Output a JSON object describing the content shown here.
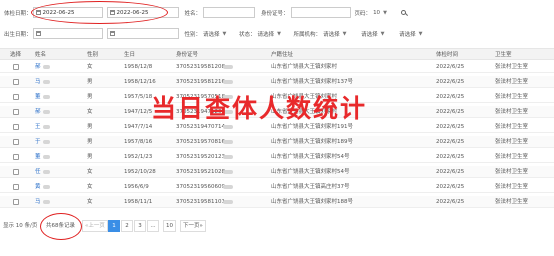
{
  "filters": {
    "exam_date_label": "体检日期：",
    "exam_date_start": "2022-06-25",
    "exam_date_end": "2022-06-25",
    "name_label": "姓名：",
    "name_value": "",
    "id_label": "身份证号：",
    "id_value": "",
    "page_label": "页码：",
    "page_value": "10",
    "birth_date_label": "出生日期：",
    "birth_date_start": "",
    "birth_date_end": "",
    "gender_label": "性别：",
    "gender_value": "请选择",
    "status_label": "状态：",
    "status_value": "请选择",
    "org_label": "所属机构：",
    "org_value": "请选择",
    "select4_value": "请选择",
    "select5_value": "请选择"
  },
  "table": {
    "headers": {
      "select": "选择",
      "name": "姓名",
      "gender": "性别",
      "birth": "生日",
      "id": "身份证号",
      "address": "户籍住址",
      "exam_time": "体检时间",
      "clinic": "卫生室"
    },
    "rows": [
      {
        "name": "郝",
        "gender": "女",
        "birth": "1958/12/8",
        "id": "37052319581208",
        "address": "山东省广饶县大王镇刘家村",
        "exam_time": "2022/6/25",
        "clinic": "张法村卫生室"
      },
      {
        "name": "马",
        "gender": "男",
        "birth": "1958/12/16",
        "id": "37052319581216",
        "address": "山东省广饶县大王镇刘家村137号",
        "exam_time": "2022/6/25",
        "clinic": "张法村卫生室"
      },
      {
        "name": "董",
        "gender": "男",
        "birth": "1957/5/18",
        "id": "37052319570518",
        "address": "山东省广饶县大王镇刘家村",
        "exam_time": "2022/6/25",
        "clinic": "张法村卫生室"
      },
      {
        "name": "郝",
        "gender": "女",
        "birth": "1947/12/5",
        "id": "37052319471205",
        "address": "山东省广饶县大王镇刘家村",
        "exam_time": "2022/6/25",
        "clinic": "张法村卫生室"
      },
      {
        "name": "王",
        "gender": "男",
        "birth": "1947/7/14",
        "id": "37052319470714",
        "address": "山东省广饶县大王镇刘家村191号",
        "exam_time": "2022/6/25",
        "clinic": "张法村卫生室"
      },
      {
        "name": "于",
        "gender": "男",
        "birth": "1957/8/16",
        "id": "37052319570816",
        "address": "山东省广饶县大王镇刘家村189号",
        "exam_time": "2022/6/25",
        "clinic": "张法村卫生室"
      },
      {
        "name": "董",
        "gender": "男",
        "birth": "1952/1/23",
        "id": "37052319520123",
        "address": "山东省广饶县大王镇刘家村54号",
        "exam_time": "2022/6/25",
        "clinic": "张法村卫生室"
      },
      {
        "name": "任",
        "gender": "女",
        "birth": "1952/10/28",
        "id": "37052319521028",
        "address": "山东省广饶县大王镇刘家村54号",
        "exam_time": "2022/6/25",
        "clinic": "张法村卫生室"
      },
      {
        "name": "黄",
        "gender": "女",
        "birth": "1956/6/9",
        "id": "37052319560609",
        "address": "山东省广饶县大王镇高庄村37号",
        "exam_time": "2022/6/25",
        "clinic": "张法村卫生室"
      },
      {
        "name": "马",
        "gender": "女",
        "birth": "1958/11/1",
        "id": "37052319581101",
        "address": "山东省广饶县大王镇刘家村188号",
        "exam_time": "2022/6/25",
        "clinic": "张法村卫生室"
      }
    ]
  },
  "overlay_text": "当日查体人数统计",
  "pagination": {
    "per_page_text": "显示 10 条/页",
    "total_text": "共68条记录",
    "prev": "«上一页",
    "pages": [
      "1",
      "2",
      "3",
      "...",
      "10"
    ],
    "next": "下一页»"
  }
}
